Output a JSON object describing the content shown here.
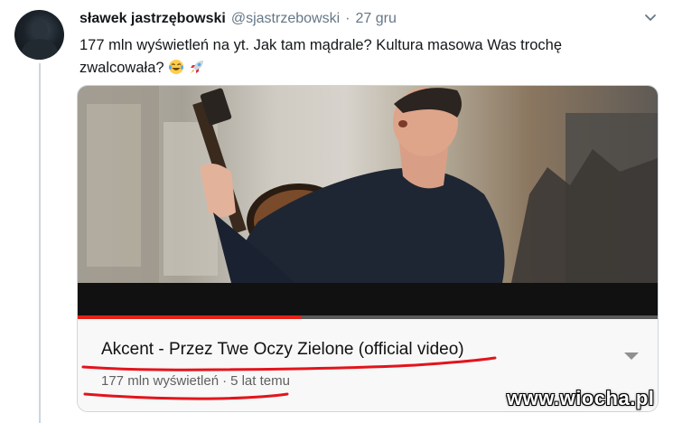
{
  "tweet": {
    "author": {
      "display_name": "sławek jastrzębowski",
      "handle": "@sjastrzebowski",
      "separator": "·",
      "date": "27 gru"
    },
    "text_line1": "177 mln wyświetleń na yt. Jak tam mądrale? Kultura masowa Was trochę",
    "text_line2": "zwalcowała?",
    "emojis": [
      "tears-of-joy-emoji",
      "rocket-emoji"
    ],
    "menu_icon": "chevron-down-icon"
  },
  "video_card": {
    "title": "Akcent - Przez Twe Oczy Zielone (official video)",
    "views": "177 mln wyświetleń",
    "meta_separator": "·",
    "age": "5 lat temu",
    "progress": 0.385,
    "expand_icon": "triangle-down-icon",
    "colors": {
      "progress": "#e62117",
      "annotation": "#e3141c"
    }
  },
  "watermark": "www.wiocha.pl"
}
